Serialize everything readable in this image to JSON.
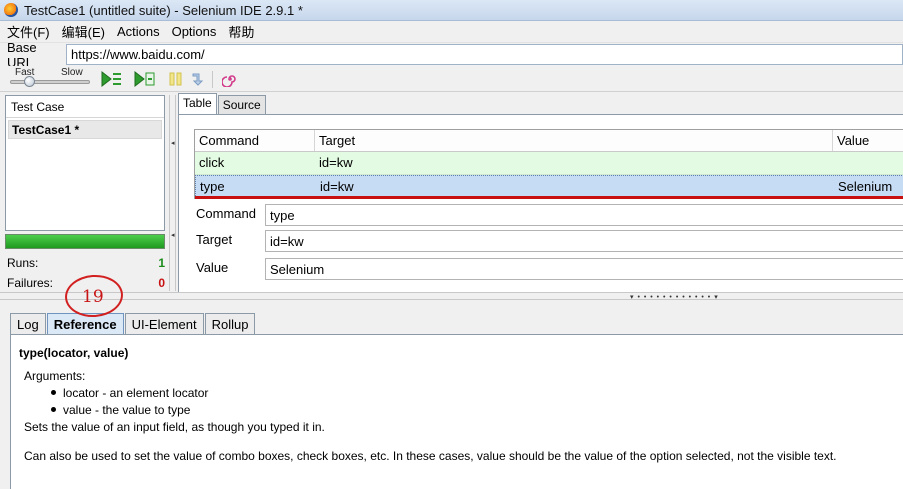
{
  "window": {
    "title": "TestCase1 (untitled suite) - Selenium IDE 2.9.1 *"
  },
  "menu": [
    "文件(F)",
    "编辑(E)",
    "Actions",
    "Options",
    "帮助"
  ],
  "base_url": {
    "label": "Base URL",
    "value": "https://www.baidu.com/"
  },
  "speed": {
    "fast": "Fast",
    "slow": "Slow",
    "level": 0.2
  },
  "test_case_panel": {
    "header": "Test Case",
    "items": [
      "TestCase1 *"
    ]
  },
  "stats": {
    "runs_label": "Runs:",
    "runs": "1",
    "failures_label": "Failures:",
    "failures": "0"
  },
  "editor_tabs": [
    "Table",
    "Source"
  ],
  "table": {
    "headers": [
      "Command",
      "Target",
      "Value"
    ],
    "rows": [
      {
        "command": "click",
        "target": "id=kw",
        "value": ""
      },
      {
        "command": "type",
        "target": "id=kw",
        "value": "Selenium"
      }
    ]
  },
  "form": {
    "command_label": "Command",
    "command": "type",
    "target_label": "Target",
    "target": "id=kw",
    "value_label": "Value",
    "value": "Selenium"
  },
  "annotation": {
    "number": "19",
    "color": "#d22020"
  },
  "bottom_tabs": [
    "Log",
    "Reference",
    "UI-Element",
    "Rollup"
  ],
  "reference": {
    "signature": "type(locator, value)",
    "arguments_label": "Arguments:",
    "arguments": [
      "locator - an element locator",
      "value - the value to type"
    ],
    "description": "Sets the value of an input field, as though you typed it in.",
    "note": "Can also be used to set the value of combo boxes, check boxes, etc. In these cases, value should be the value of the option selected, not the visible text."
  },
  "colors": {
    "selected_row": "#c6dcf4",
    "executed_row": "#e3fbe3",
    "progress": "#2fb52f",
    "runs": "#1a8a1a",
    "failures": "#c81010"
  }
}
